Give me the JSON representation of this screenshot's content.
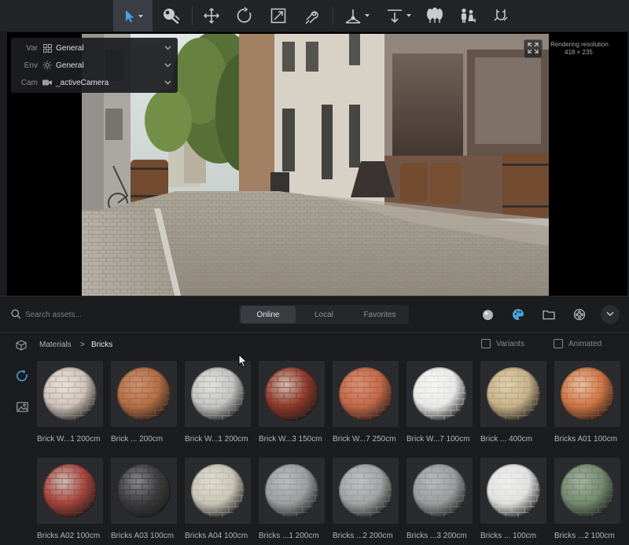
{
  "toolbar": {
    "tools": [
      {
        "name": "select-tool",
        "icon": "arrow-cursor-icon",
        "active": true
      },
      {
        "name": "material-picker-tool",
        "icon": "material-picker-icon"
      },
      {
        "name": "move-tool",
        "icon": "move-arrows-icon"
      },
      {
        "name": "rotate-tool",
        "icon": "rotate-icon"
      },
      {
        "name": "scale-tool",
        "icon": "scale-icon"
      },
      {
        "name": "place-tool",
        "icon": "place-on-surface-icon"
      },
      {
        "name": "pivot-tool",
        "icon": "pivot-axes-icon"
      },
      {
        "name": "align-tool",
        "icon": "align-ground-icon"
      },
      {
        "name": "scatter-tool",
        "icon": "trees-icon"
      },
      {
        "name": "people-tool",
        "icon": "people-icon"
      },
      {
        "name": "snap-tool",
        "icon": "snap-magnet-icon"
      }
    ]
  },
  "viewport": {
    "overlay": [
      {
        "key": "Var",
        "icon": "grid-icon",
        "value": "General"
      },
      {
        "key": "Env",
        "icon": "sun-icon",
        "value": "General"
      },
      {
        "key": "Cam",
        "icon": "camera-icon",
        "value": "_activeCamera"
      }
    ],
    "rendering_resolution_label": "Rendering resolution",
    "rendering_resolution_value": "418 × 235"
  },
  "browser": {
    "search_placeholder": "Search assets...",
    "tabs": [
      {
        "label": "Online",
        "active": true
      },
      {
        "label": "Local",
        "active": false
      },
      {
        "label": "Favorites",
        "active": false
      }
    ],
    "breadcrumb": {
      "root": "Materials",
      "separator": ">",
      "current": "Bricks"
    },
    "filters": [
      {
        "label": "Variants",
        "checked": false
      },
      {
        "label": "Animated",
        "checked": false
      }
    ],
    "assets": [
      {
        "label": "Brick W...1 200cm",
        "base": "#cfc4bc",
        "mortar": "#e8e2dc",
        "brick": "#a88d84"
      },
      {
        "label": "Brick ... 200cm",
        "base": "#b26f47",
        "mortar": "#c99474",
        "brick": "#9a5630"
      },
      {
        "label": "Brick W...1 200cm",
        "base": "#c3c3c1",
        "mortar": "#e2e2e0",
        "brick": "#9e9e9c"
      },
      {
        "label": "Brick W...3 150cm",
        "base": "#8d3a2c",
        "mortar": "#d0c0b2",
        "brick": "#7a2a1e"
      },
      {
        "label": "Brick W...7 250cm",
        "base": "#c2694a",
        "mortar": "#d69378",
        "brick": "#a84f33"
      },
      {
        "label": "Brick W...7 100cm",
        "base": "#e9e9e7",
        "mortar": "#f6f6f4",
        "brick": "#d2d2d0"
      },
      {
        "label": "Brick ... 400cm",
        "base": "#c7b28a",
        "mortar": "#ded0b0",
        "brick": "#a8926b"
      },
      {
        "label": "Bricks A01 100cm",
        "base": "#cc7446",
        "mortar": "#e4c2a6",
        "brick": "#b45c2f"
      },
      {
        "label": "Bricks A02 100cm",
        "base": "#a5453d",
        "mortar": "#c9bfb8",
        "brick": "#8e3530"
      },
      {
        "label": "Bricks A03 100cm",
        "base": "#3d3d3f",
        "mortar": "#8a8a8c",
        "brick": "#2d2d2f"
      },
      {
        "label": "Bricks A04 100cm",
        "base": "#c9c6b8",
        "mortar": "#e0ddd0",
        "brick": "#b0ad9e"
      },
      {
        "label": "Bricks ...1 200cm",
        "base": "#9d9e9f",
        "mortar": "#bcbdbe",
        "brick": "#878889"
      },
      {
        "label": "Bricks ...2 200cm",
        "base": "#a3a4a5",
        "mortar": "#c0c1c2",
        "brick": "#8b8c8d"
      },
      {
        "label": "Bricks ...3 200cm",
        "base": "#9c9d9e",
        "mortar": "#b8b9ba",
        "brick": "#858687"
      },
      {
        "label": "Bricks ... 100cm",
        "base": "#e1e1e0",
        "mortar": "#f0f0ef",
        "brick": "#cfcfce"
      },
      {
        "label": "Bricks ...2 100cm",
        "base": "#768a70",
        "mortar": "#a3b29e",
        "brick": "#60755a"
      }
    ]
  },
  "colors": {
    "accent": "#4aa3df",
    "panel": "#1b1c1e",
    "tile": "#2a2b2e"
  }
}
